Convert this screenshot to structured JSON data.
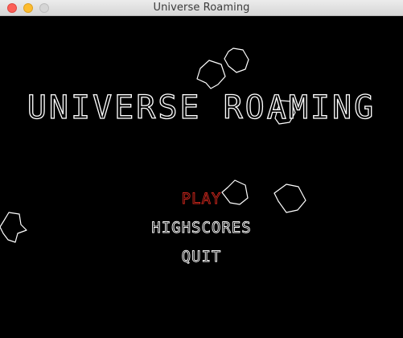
{
  "window": {
    "title": "Universe Roaming"
  },
  "game": {
    "title": "UNIVERSE ROAMING",
    "menu": {
      "play": "PLAY",
      "highscores": "HIGHSCORES",
      "quit": "QUIT",
      "selected": "PLAY"
    }
  },
  "colors": {
    "background": "#000000",
    "text": "#ffffff",
    "selected": "#d0271d"
  }
}
